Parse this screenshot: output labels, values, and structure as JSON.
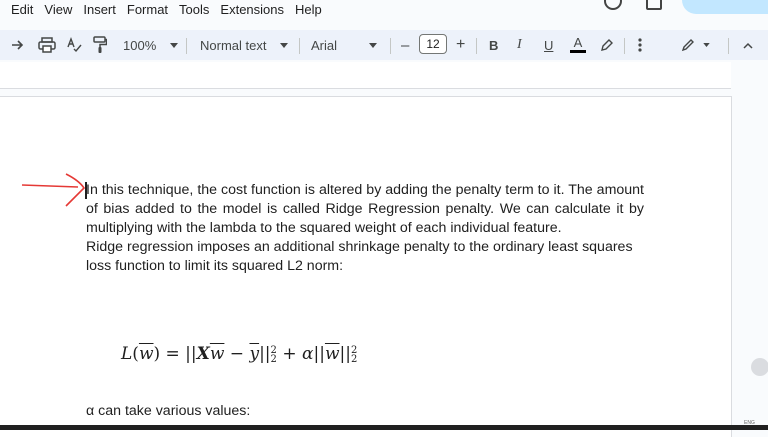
{
  "menu": [
    "Edit",
    "View",
    "Insert",
    "Format",
    "Tools",
    "Extensions",
    "Help"
  ],
  "toolbar": {
    "zoom": "100%",
    "style": "Normal text",
    "font": "Arial",
    "font_size": "12",
    "minus": "–",
    "plus": "+",
    "bold": "B",
    "italic": "I",
    "underline": "U",
    "text_color": "A"
  },
  "document": {
    "para1": "In this technique, the cost function is altered by adding the penalty term to it. The amount of bias added to the model is called Ridge Regression penalty. We can calculate it by multiplying with the lambda to the squared weight of each individual feature.",
    "para2": "Ridge regression imposes an additional shrinkage penalty to the ordinary least squares loss function to limit its squared L2 norm:",
    "formula": "L(w̅) = ||Xw̅ − y̅||²₂ + α||w̅||²₂",
    "para3": "α can take various values:"
  },
  "taskbar": {
    "lang": "ENG"
  },
  "colors": {
    "arrow": "#e53935",
    "toolbar_bg": "#edf2fa",
    "underline_bar": "#000000"
  }
}
